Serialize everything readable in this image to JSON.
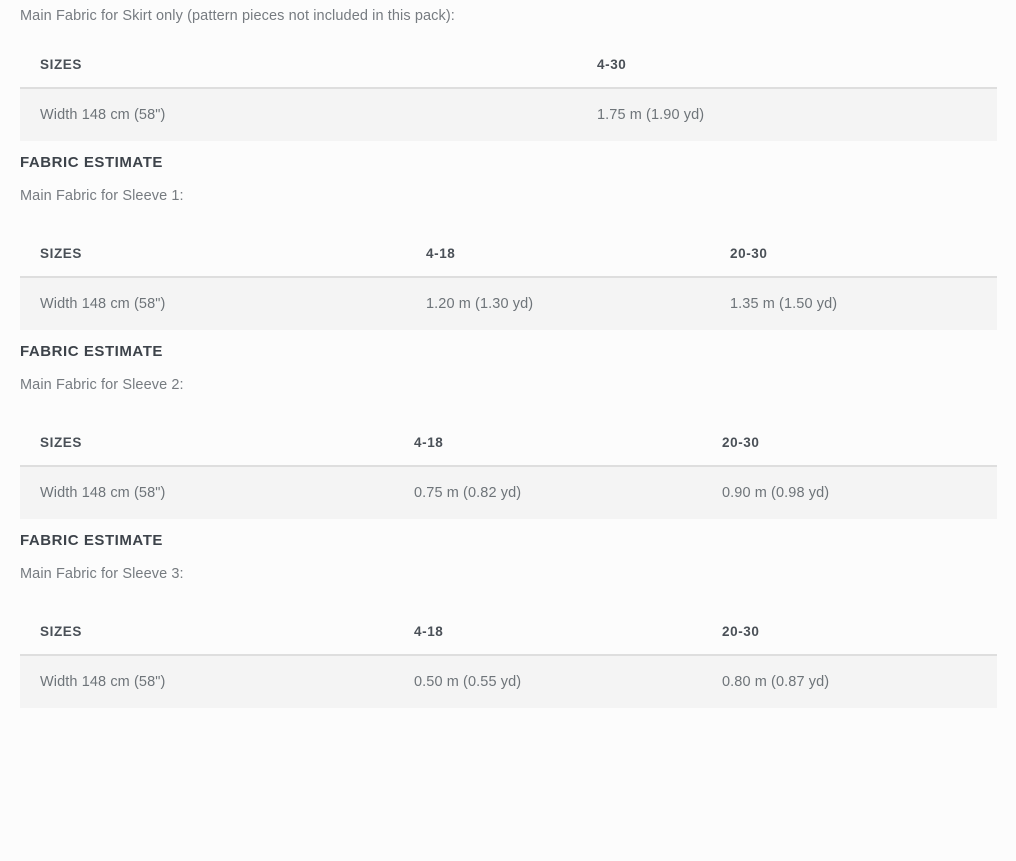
{
  "intro": {
    "paragraph": "Main Fabric for Skirt only (pattern pieces not included in this pack):"
  },
  "sections": [
    {
      "id": "skirt",
      "heading": null,
      "paragraph": null,
      "table": {
        "columns": [
          "SIZES",
          "4-30"
        ],
        "rows": [
          [
            "Width 148 cm (58\")",
            "1.75 m (1.90 yd)"
          ]
        ]
      }
    },
    {
      "id": "sleeve-1",
      "heading": "FABRIC ESTIMATE",
      "paragraph": "Main Fabric for Sleeve 1:",
      "table": {
        "columns": [
          "SIZES",
          "4-18",
          "20-30"
        ],
        "rows": [
          [
            "Width 148 cm (58\")",
            "1.20 m (1.30 yd)",
            "1.35 m (1.50 yd)"
          ]
        ]
      }
    },
    {
      "id": "sleeve-2",
      "heading": "FABRIC ESTIMATE",
      "paragraph": "Main Fabric for Sleeve 2:",
      "table": {
        "columns": [
          "SIZES",
          "4-18",
          "20-30"
        ],
        "rows": [
          [
            "Width 148 cm (58\")",
            "0.75 m (0.82 yd)",
            "0.90 m (0.98 yd)"
          ]
        ]
      }
    },
    {
      "id": "sleeve-3",
      "heading": "FABRIC ESTIMATE",
      "paragraph": "Main Fabric for Sleeve 3:",
      "table": {
        "columns": [
          "SIZES",
          "4-18",
          "20-30"
        ],
        "rows": [
          [
            "Width 148 cm (58\")",
            "0.50 m (0.55 yd)",
            "0.80 m (0.87 yd)"
          ]
        ]
      }
    }
  ],
  "colors": {
    "page_background": "#fcfcfc",
    "row_background": "#f4f4f4",
    "row_border": "#dedede",
    "heading_text": "#3d434a",
    "body_text": "#767b80",
    "table_header_text": "#4a5057",
    "table_cell_text": "#6e7479"
  }
}
